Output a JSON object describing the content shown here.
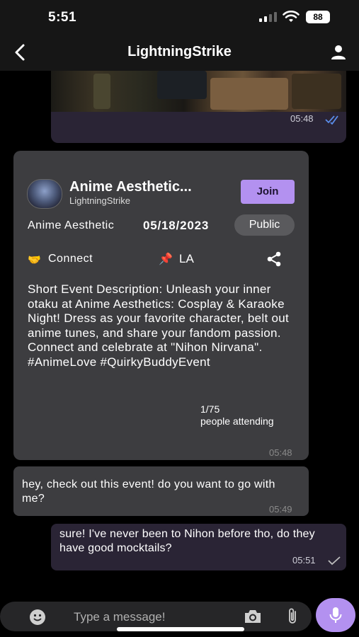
{
  "status_bar": {
    "time": "5:51",
    "battery": "88"
  },
  "header": {
    "title": "LightningStrike",
    "back_icon": "chevron-left-icon",
    "profile_icon": "person-icon"
  },
  "image_message": {
    "time": "05:48",
    "status_icon": "double-check-icon"
  },
  "event_card": {
    "title": "Anime Aesthetic...",
    "host": "LightningStrike",
    "join_label": "Join",
    "category": "Anime Aesthetic",
    "date": "05/18/2023",
    "visibility": "Public",
    "connect_icon": "🤝",
    "connect_label": "Connect",
    "location_icon": "📌",
    "location": "LA",
    "description": "Short Event Description: Unleash your inner otaku at Anime Aesthetics: Cosplay & Karaoke Night! Dress as your favorite character, belt out anime tunes, and share your fandom passion. Connect and celebrate at \"Nihon Nirvana\". #AnimeLove #QuirkyBuddyEvent",
    "attendance_count": "1/75",
    "attendance_label": "people attending",
    "time": "05:48"
  },
  "messages": [
    {
      "direction": "incoming",
      "text": "hey, check out this event! do you want to go with me?",
      "time": "05:49"
    },
    {
      "direction": "outgoing",
      "text": "sure! I've never been to Nihon before tho, do they have good mocktails?",
      "time": "05:51"
    }
  ],
  "composer": {
    "placeholder": "Type a message!"
  },
  "colors": {
    "accent": "#b391f0",
    "outgoing_bubble": "#2a2435",
    "incoming_bubble": "#3d3d40",
    "read_ticks": "#5b8dea"
  }
}
